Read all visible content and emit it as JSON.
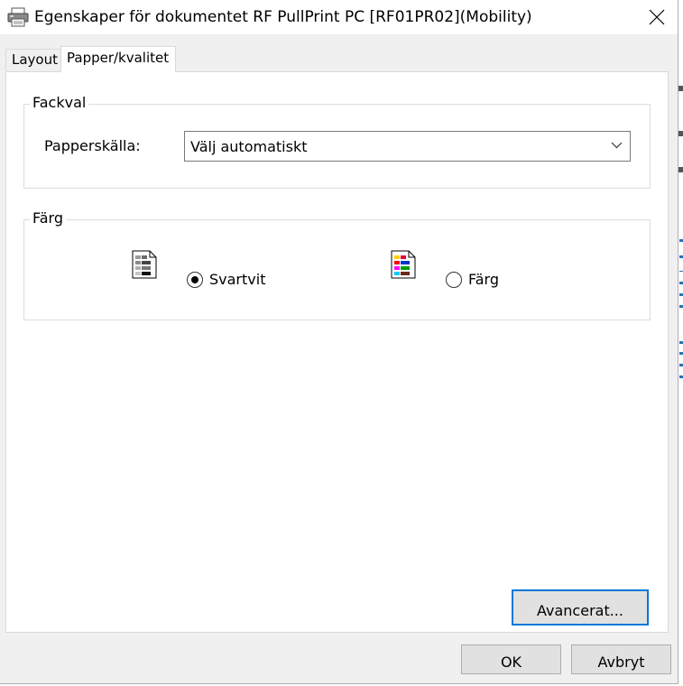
{
  "window": {
    "title": "Egenskaper för dokumentet RF PullPrint PC [RF01PR02](Mobility)"
  },
  "tabs": [
    {
      "label": "Layout",
      "active": false
    },
    {
      "label": "Papper/kvalitet",
      "active": true
    }
  ],
  "tray_group": {
    "legend": "Fackval",
    "paper_source_label": "Papperskälla:",
    "paper_source_value": "Välj automatiskt"
  },
  "color_group": {
    "legend": "Färg",
    "options": [
      {
        "label": "Svartvit",
        "selected": true,
        "icon": "black-white-document-icon"
      },
      {
        "label": "Färg",
        "selected": false,
        "icon": "color-document-icon"
      }
    ]
  },
  "buttons": {
    "advanced": "Avancerat...",
    "ok": "OK",
    "cancel": "Avbryt"
  },
  "colors": {
    "focus_border": "#0078d7",
    "button_bg": "#e1e1e1",
    "window_bg": "#f0f0f0"
  }
}
